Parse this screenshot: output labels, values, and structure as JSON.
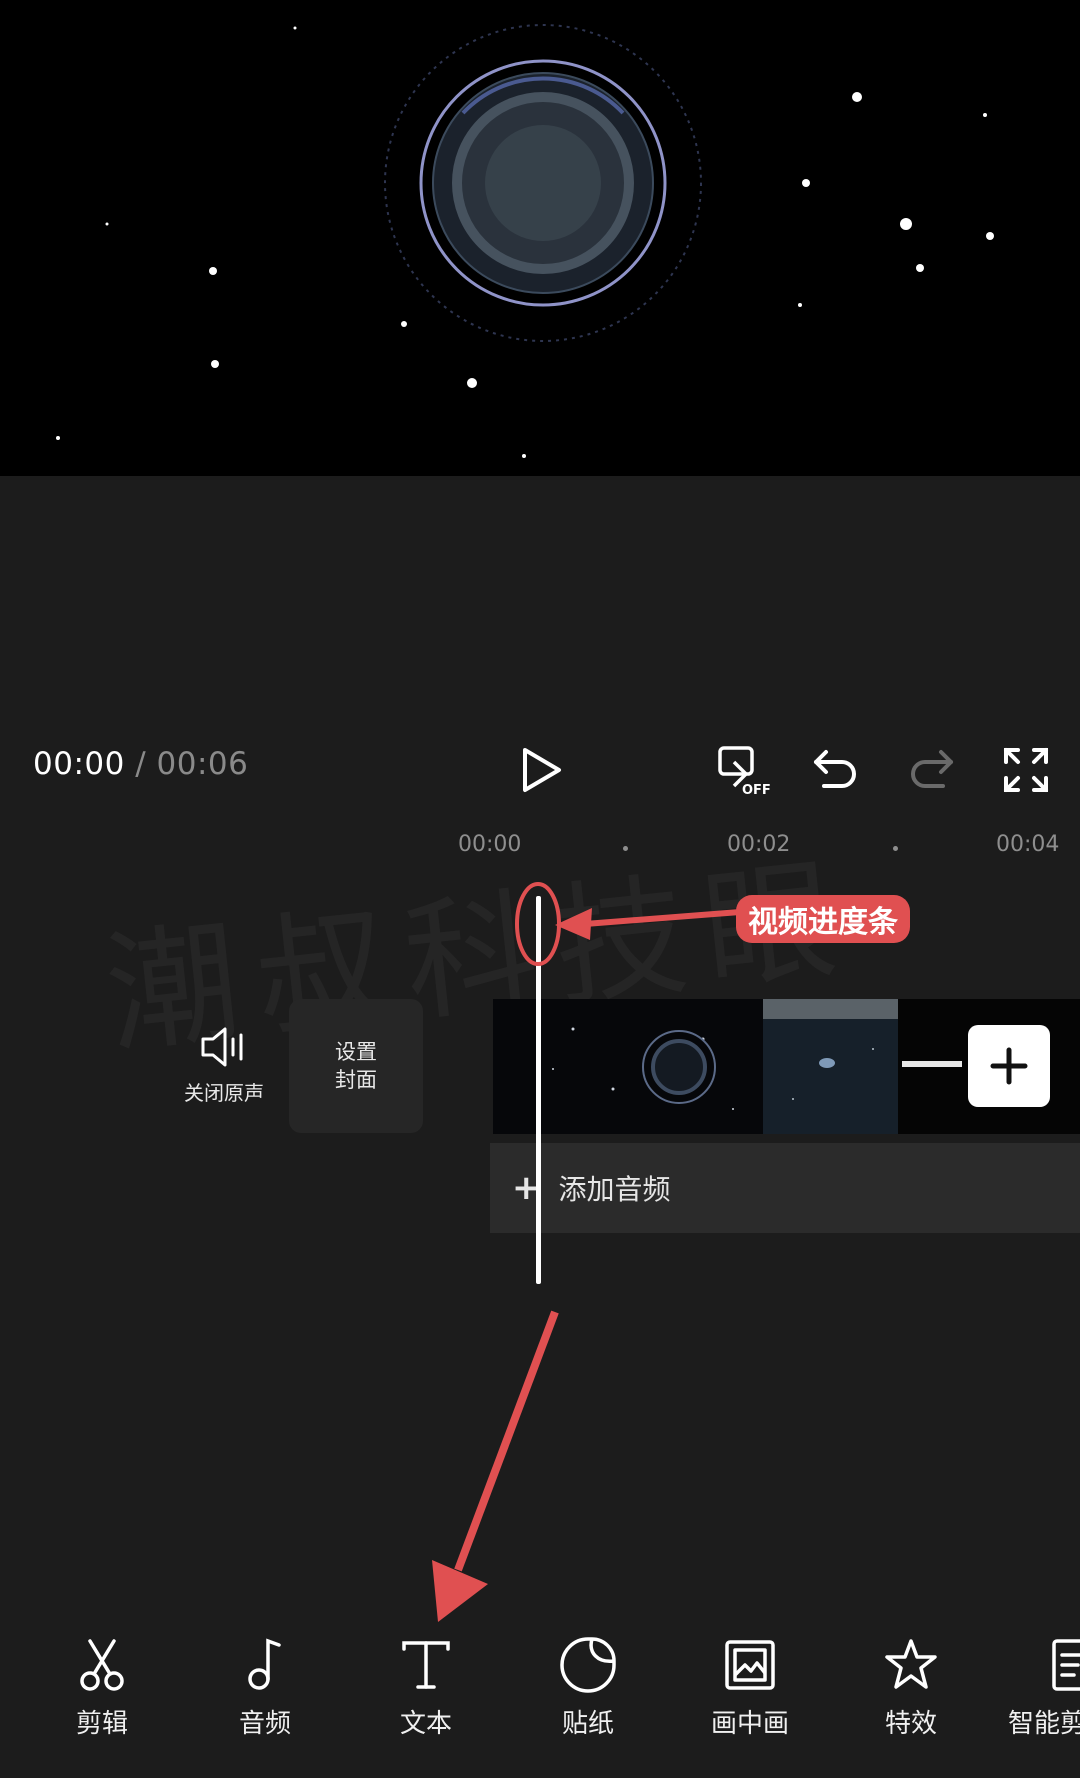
{
  "playbar": {
    "current_time": "00:00",
    "separator": " / ",
    "total_time": "00:06"
  },
  "ruler": {
    "labels": [
      "00:00",
      "00:02",
      "00:04"
    ]
  },
  "watermark": "潮叔科技眼",
  "timeline": {
    "mute_label": "关闭原声",
    "cover_line1": "设置",
    "cover_line2": "封面",
    "add_audio_label": "添加音频"
  },
  "annotation": {
    "label": "视频进度条",
    "color": "#e05051"
  },
  "toolbar": {
    "items": [
      {
        "label": "剪辑",
        "icon": "scissors-icon"
      },
      {
        "label": "音频",
        "icon": "music-note-icon"
      },
      {
        "label": "文本",
        "icon": "text-icon"
      },
      {
        "label": "贴纸",
        "icon": "sticker-icon"
      },
      {
        "label": "画中画",
        "icon": "picture-in-picture-icon"
      },
      {
        "label": "特效",
        "icon": "effects-star-icon"
      },
      {
        "label": "智能剪",
        "icon": "smart-edit-icon"
      }
    ]
  },
  "colors": {
    "background": "#1c1c1c",
    "accent": "#e05051"
  }
}
